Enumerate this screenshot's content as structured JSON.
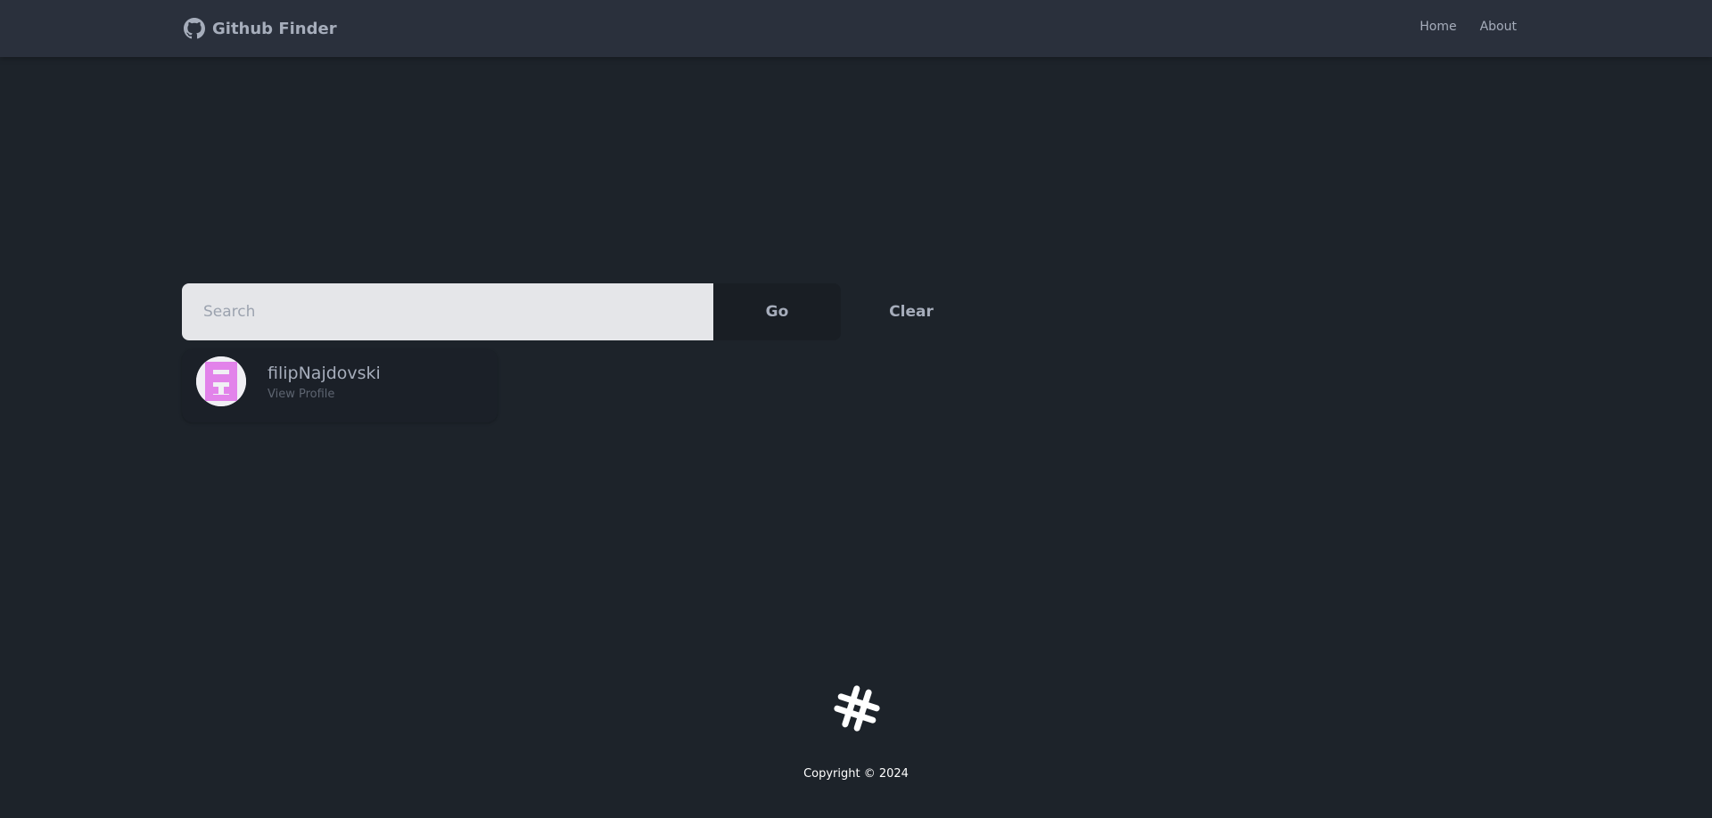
{
  "navbar": {
    "brand_icon": "github-icon",
    "brand_title": "Github Finder",
    "links": [
      {
        "label": "Home"
      },
      {
        "label": "About"
      }
    ]
  },
  "search": {
    "placeholder": "Search",
    "value": "",
    "go_label": "Go",
    "clear_label": "Clear"
  },
  "results": [
    {
      "login": "filipNajdovski",
      "link_label": "View Profile",
      "avatar_icon": "identicon-avatar"
    }
  ],
  "footer": {
    "logo_icon": "hashtag-logo-icon",
    "copyright": "Copyright © 2024"
  },
  "colors": {
    "background": "#1d232a",
    "navbar": "#2a303c",
    "input": "#e5e6e9",
    "go_button": "#191e24",
    "avatar_accent": "#e283ea"
  }
}
